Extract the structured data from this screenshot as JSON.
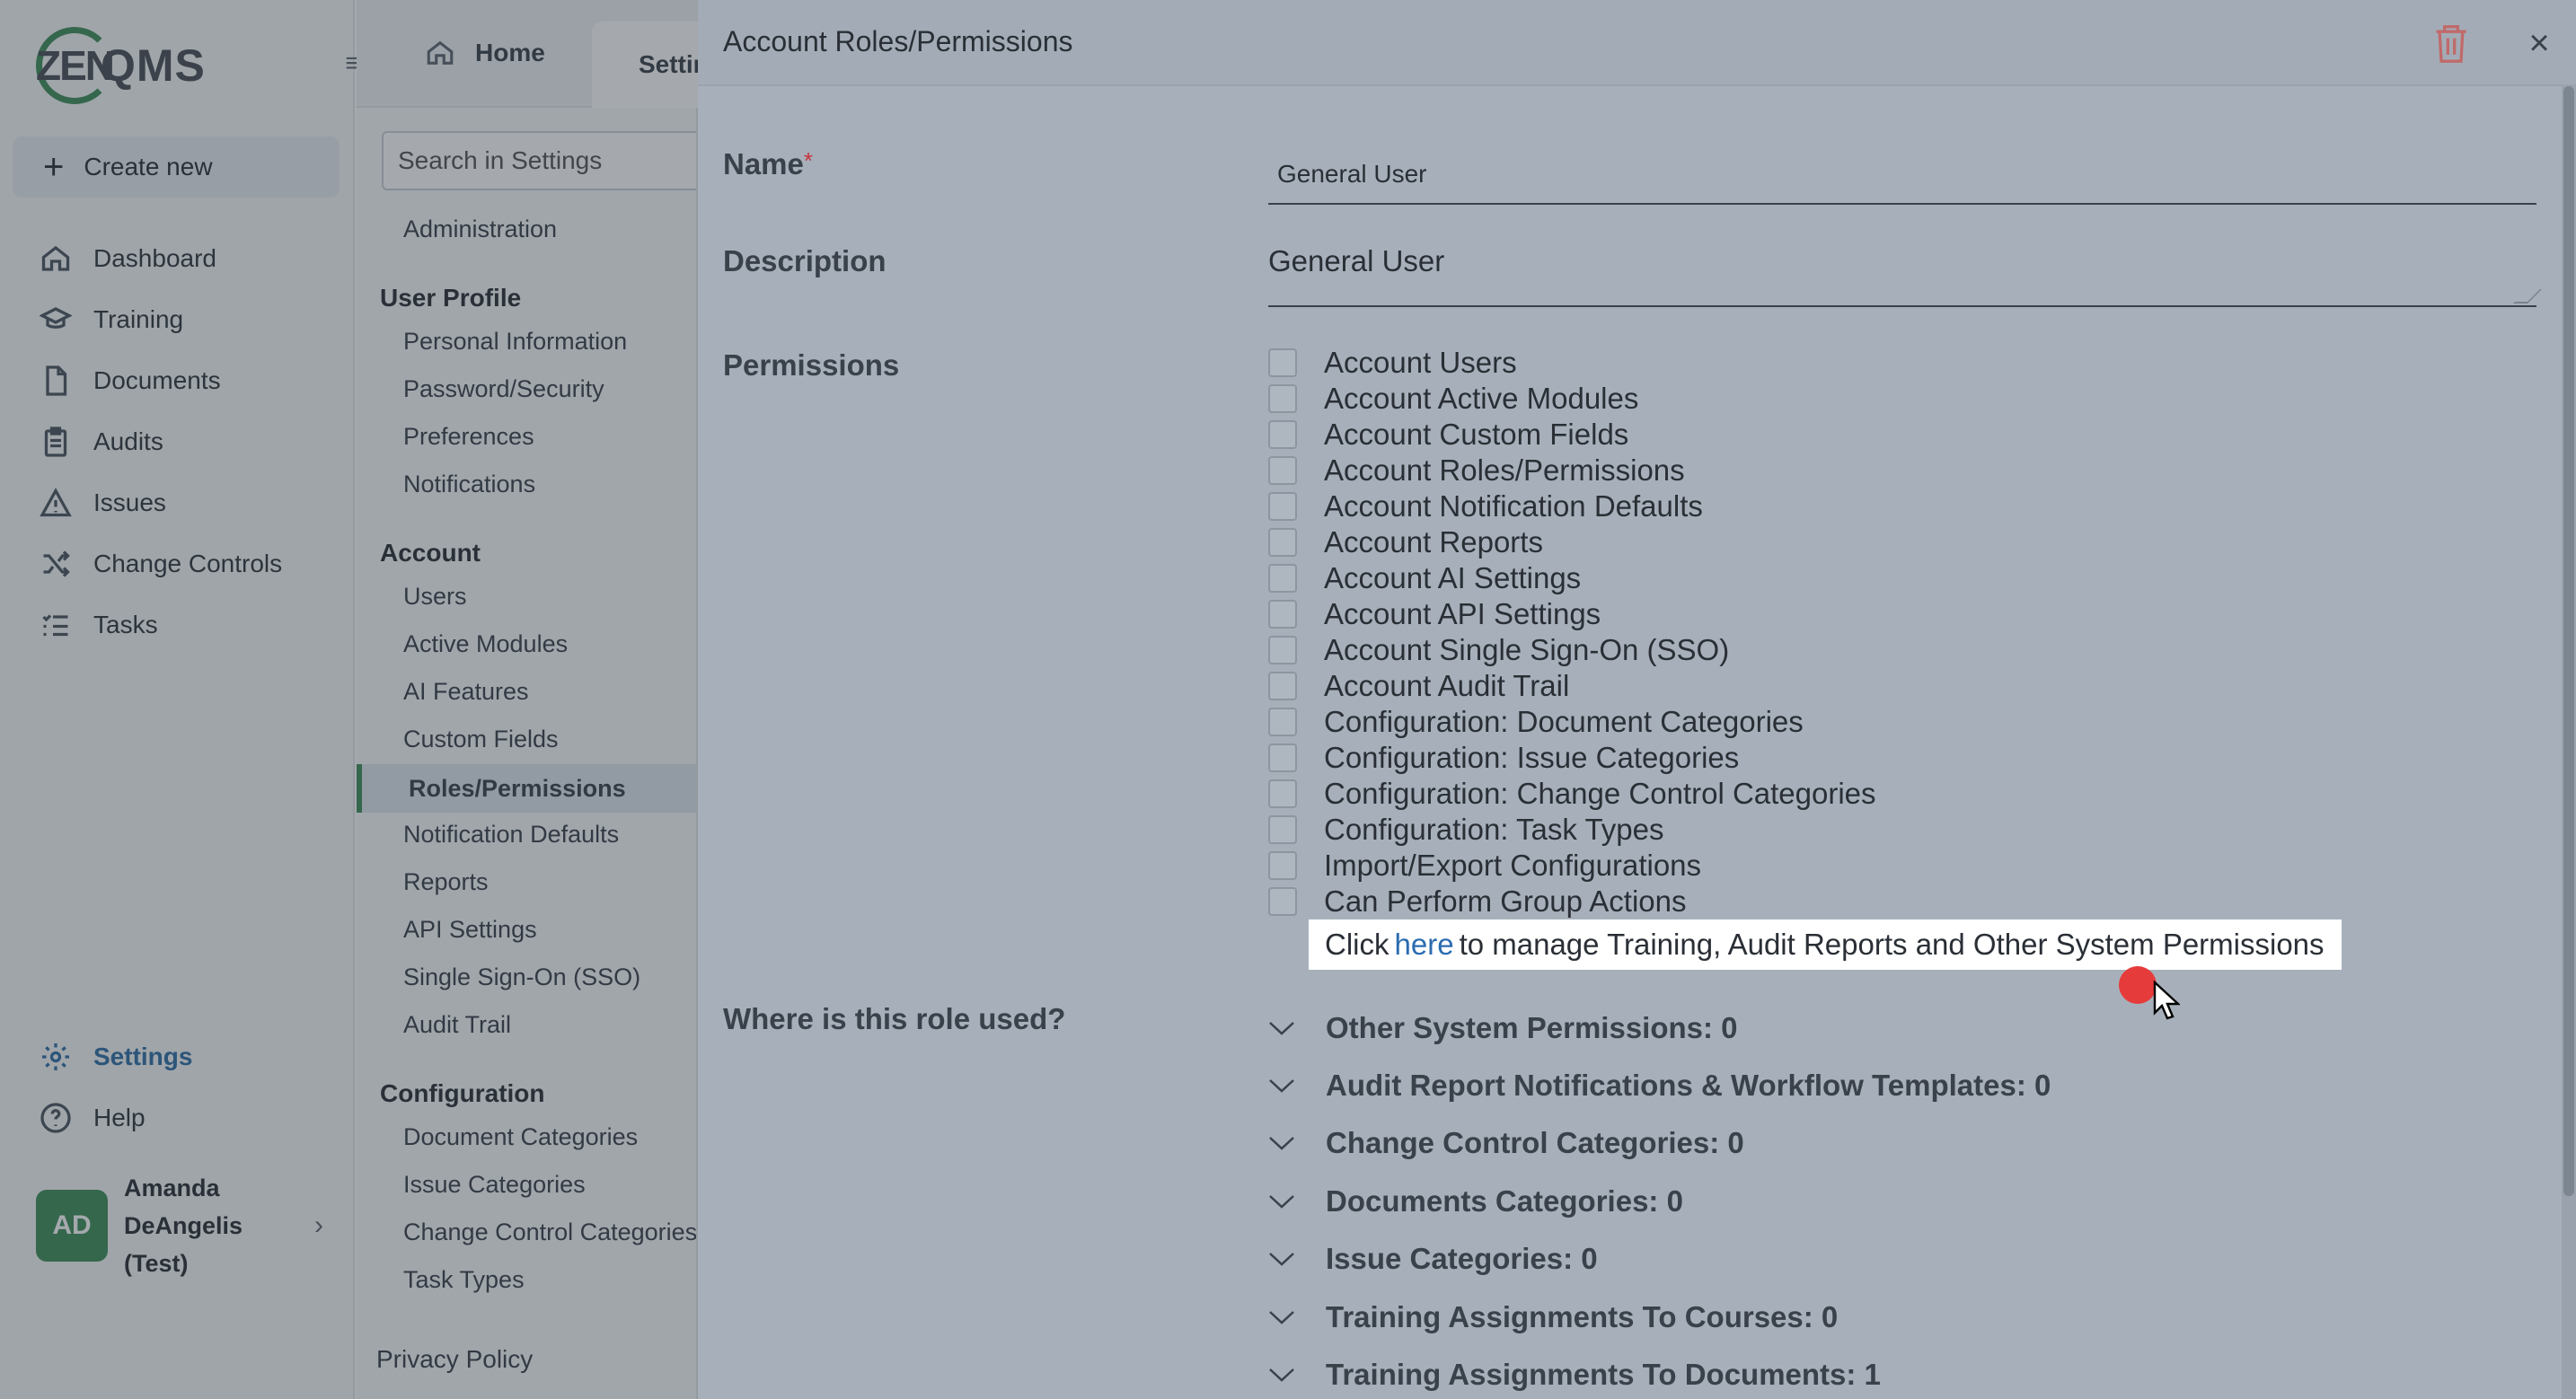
{
  "app": {
    "logo_zen": "ZEN",
    "logo_qms": "QMS"
  },
  "nav": {
    "create_new": "Create new",
    "items": [
      {
        "label": "Dashboard",
        "icon": "home-icon"
      },
      {
        "label": "Training",
        "icon": "graduation-cap-icon"
      },
      {
        "label": "Documents",
        "icon": "document-icon"
      },
      {
        "label": "Audits",
        "icon": "clipboard-icon"
      },
      {
        "label": "Issues",
        "icon": "warning-icon"
      },
      {
        "label": "Change Controls",
        "icon": "shuffle-icon"
      },
      {
        "label": "Tasks",
        "icon": "list-icon"
      }
    ],
    "settings": "Settings",
    "help": "Help",
    "user": {
      "initials": "AD",
      "name": "Amanda DeAngelis (Test)"
    }
  },
  "tabs": {
    "home": "Home",
    "settings": "Settings"
  },
  "settings_panel": {
    "search_placeholder": "Search in Settings",
    "administration": "Administration",
    "user_profile_heading": "User Profile",
    "user_profile": [
      "Personal Information",
      "Password/Security",
      "Preferences",
      "Notifications"
    ],
    "account_heading": "Account",
    "account": [
      "Users",
      "Active Modules",
      "AI Features",
      "Custom Fields",
      "Roles/Permissions",
      "Notification Defaults",
      "Reports",
      "API Settings",
      "Single Sign-On (SSO)",
      "Audit Trail"
    ],
    "configuration_heading": "Configuration",
    "configuration": [
      "Document Categories",
      "Issue Categories",
      "Change Control Categories",
      "Task Types"
    ],
    "privacy": "Privacy Policy"
  },
  "drawer": {
    "title": "Account Roles/Permissions",
    "name_label": "Name",
    "required_mark": "*",
    "name_value": "General User",
    "description_label": "Description",
    "description_value": "General User",
    "permissions_label": "Permissions",
    "permissions": [
      "Account Users",
      "Account Active Modules",
      "Account Custom Fields",
      "Account Roles/Permissions",
      "Account Notification Defaults",
      "Account Reports",
      "Account AI Settings",
      "Account API Settings",
      "Account Single Sign-On (SSO)",
      "Account Audit Trail",
      "Configuration: Document Categories",
      "Configuration: Issue Categories",
      "Configuration: Change Control Categories",
      "Configuration: Task Types",
      "Import/Export Configurations",
      "Can Perform Group Actions"
    ],
    "tooltip": {
      "prefix": "Click",
      "link": "here",
      "suffix": "to manage Training, Audit Reports and Other System Permissions"
    },
    "usage_label": "Where is this role used?",
    "usage": [
      "Other System Permissions: 0",
      "Audit Report Notifications & Workflow Templates: 0",
      "Change Control Categories: 0",
      "Documents Categories: 0",
      "Issue Categories: 0",
      "Training Assignments To Courses: 0",
      "Training Assignments To Documents: 1"
    ]
  },
  "colors": {
    "brand_green": "#3e8e5a",
    "link_blue": "#2b6cb0",
    "required_red": "#c8333f"
  }
}
